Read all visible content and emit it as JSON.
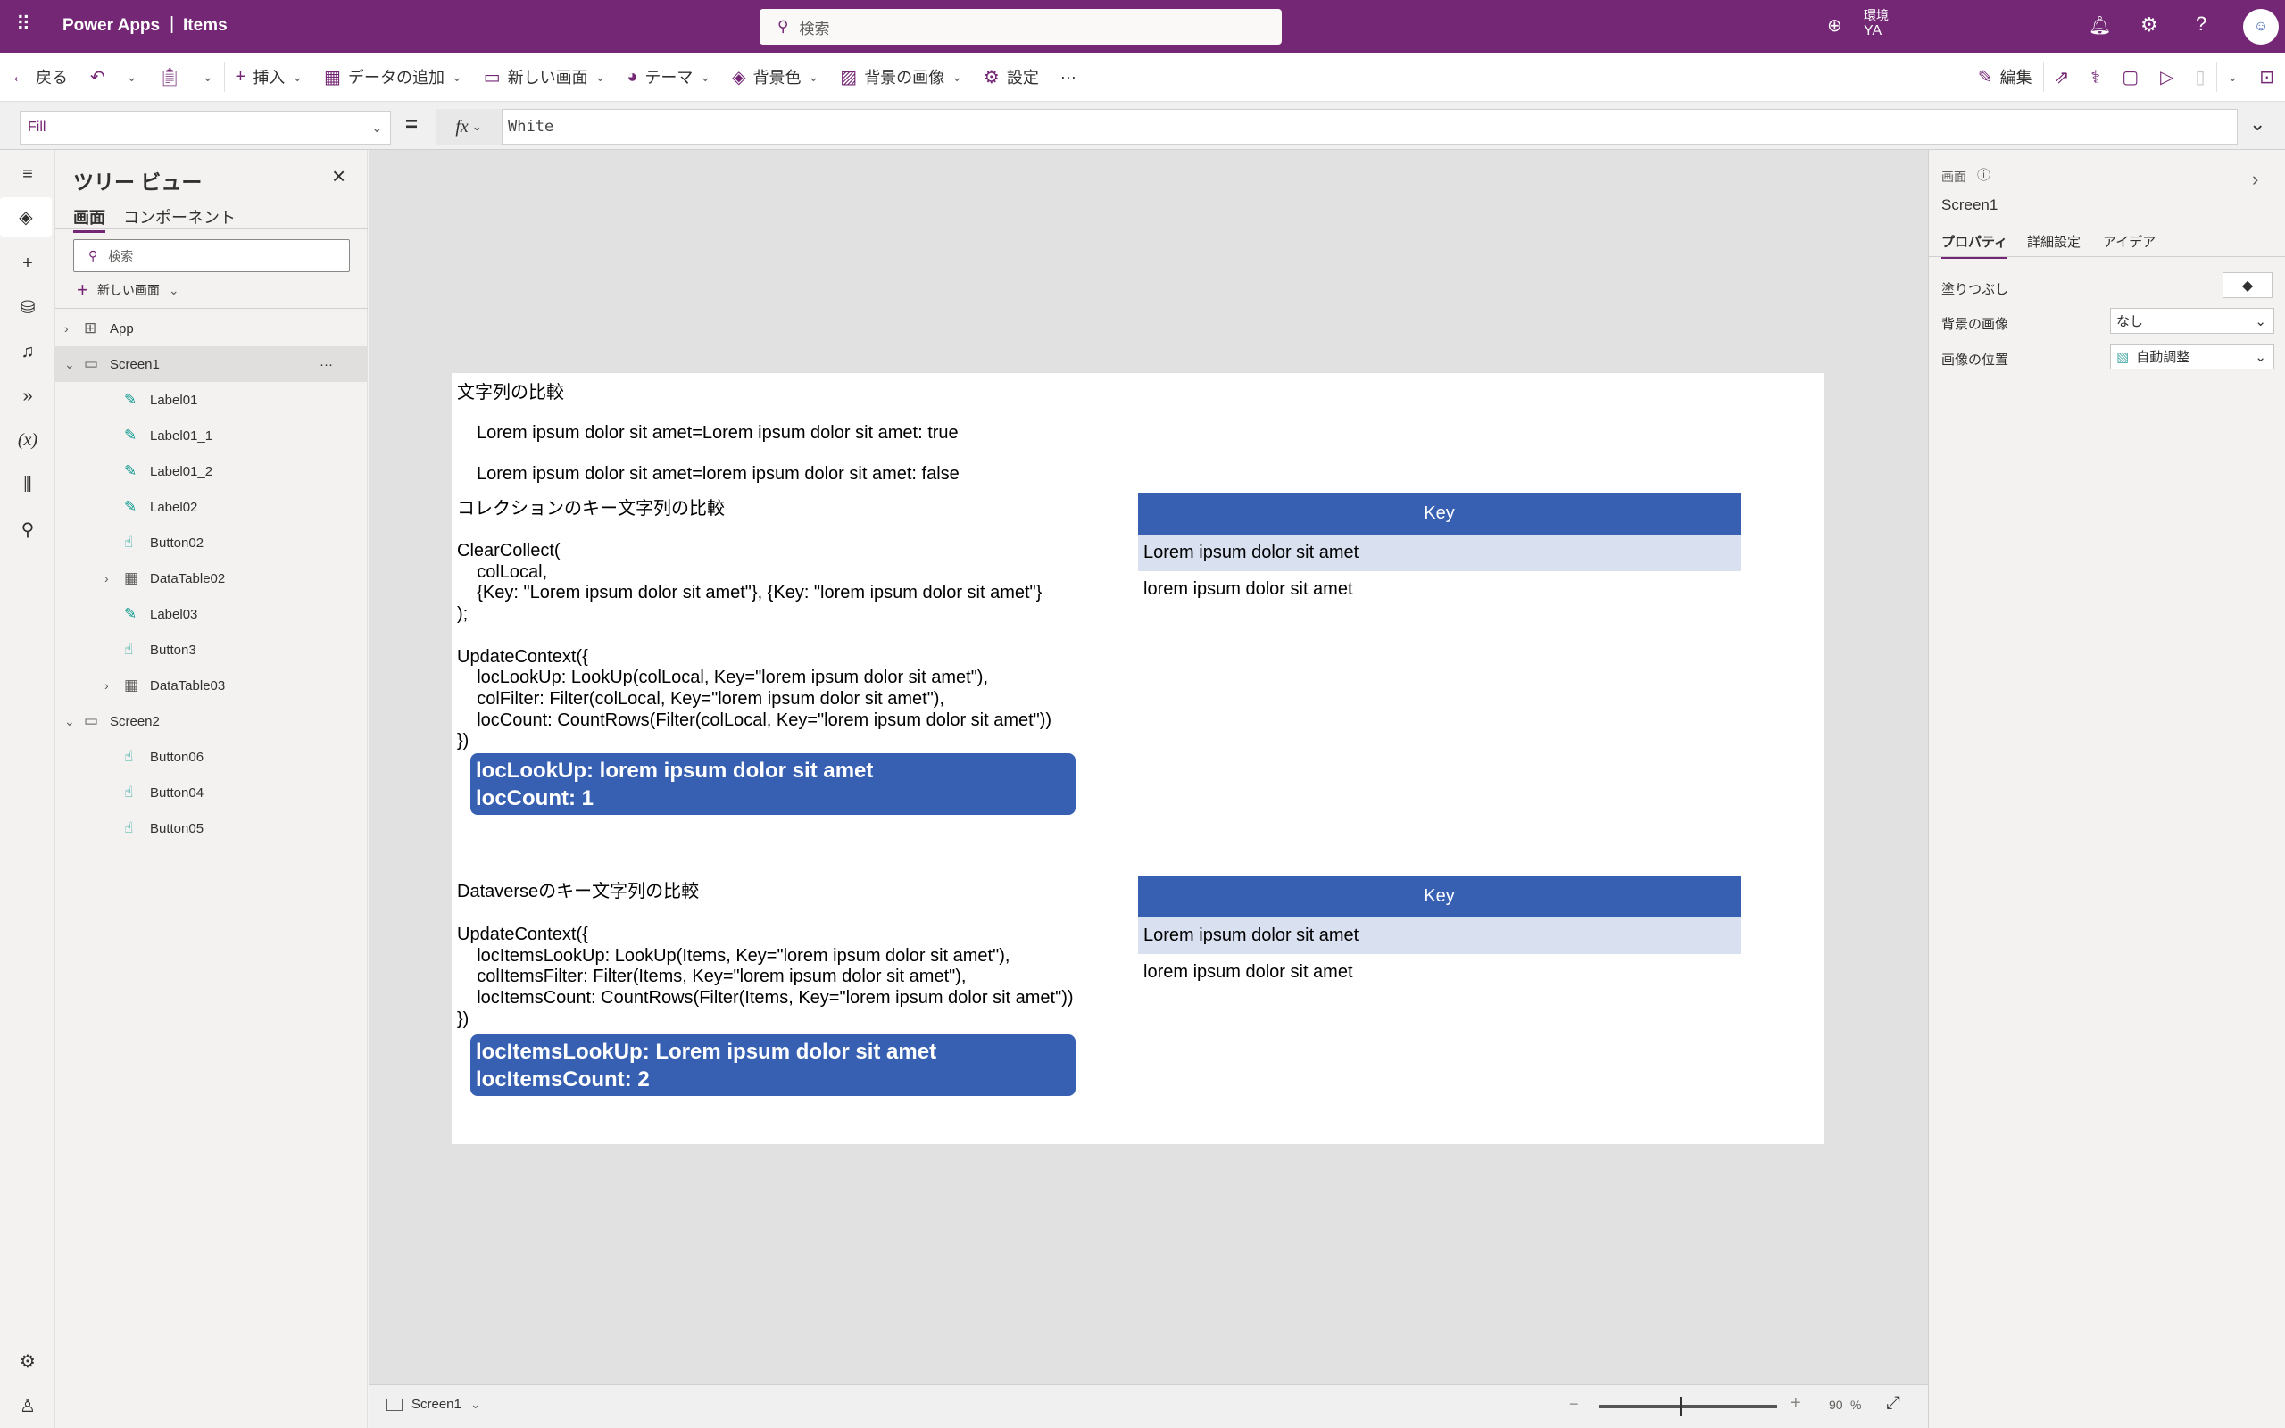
{
  "header": {
    "app_name": "Power Apps",
    "separator": "|",
    "app_title": "Items",
    "search_placeholder": "検索",
    "env_label": "環境",
    "env_name": "YA"
  },
  "toolbar": {
    "back": "戻る",
    "insert": "挿入",
    "add_data": "データの追加",
    "new_screen": "新しい画面",
    "theme": "テーマ",
    "bg_color": "背景色",
    "bg_image": "背景の画像",
    "settings": "設定",
    "more": "···",
    "edit": "編集"
  },
  "formula": {
    "property": "Fill",
    "equals": "=",
    "fx": "fx",
    "value": "White"
  },
  "tree": {
    "title": "ツリー ビュー",
    "tabs": [
      "画面",
      "コンポーネント"
    ],
    "search_placeholder": "検索",
    "new_screen": "新しい画面",
    "items": [
      {
        "label": "App",
        "level": 0,
        "icon": "app",
        "expander": ">"
      },
      {
        "label": "Screen1",
        "level": 0,
        "icon": "screen",
        "expander": "v",
        "selected": true
      },
      {
        "label": "Label01",
        "level": 1,
        "icon": "label"
      },
      {
        "label": "Label01_1",
        "level": 1,
        "icon": "label"
      },
      {
        "label": "Label01_2",
        "level": 1,
        "icon": "label"
      },
      {
        "label": "Label02",
        "level": 1,
        "icon": "label"
      },
      {
        "label": "Button02",
        "level": 1,
        "icon": "button"
      },
      {
        "label": "DataTable02",
        "level": 1,
        "icon": "table",
        "expander": ">"
      },
      {
        "label": "Label03",
        "level": 1,
        "icon": "label"
      },
      {
        "label": "Button3",
        "level": 1,
        "icon": "button"
      },
      {
        "label": "DataTable03",
        "level": 1,
        "icon": "table",
        "expander": ">"
      },
      {
        "label": "Screen2",
        "level": 0,
        "icon": "screen",
        "expander": "v"
      },
      {
        "label": "Button06",
        "level": 1,
        "icon": "button"
      },
      {
        "label": "Button04",
        "level": 1,
        "icon": "button"
      },
      {
        "label": "Button05",
        "level": 1,
        "icon": "button"
      }
    ],
    "more": "···"
  },
  "canvas": {
    "heading1": "文字列の比較",
    "compare_true": "Lorem ipsum dolor sit amet=Lorem ipsum dolor sit amet: true",
    "compare_false": "Lorem ipsum dolor sit amet=lorem ipsum dolor sit amet: false",
    "heading2": "コレクションのキー文字列の比較",
    "code1": [
      "ClearCollect(",
      "    colLocal,",
      "    {Key: \"Lorem ipsum dolor sit amet\"}, {Key: \"lorem ipsum dolor sit amet\"}",
      ");",
      "",
      "UpdateContext({",
      "    locLookUp: LookUp(colLocal, Key=\"lorem ipsum dolor sit amet\"),",
      "    colFilter: Filter(colLocal, Key=\"lorem ipsum dolor sit amet\"),",
      "    locCount: CountRows(Filter(colLocal, Key=\"lorem ipsum dolor sit amet\"))",
      "})"
    ],
    "result1": [
      "locLookUp: lorem ipsum dolor sit amet",
      "locCount: 1"
    ],
    "heading3": "Dataverseのキー文字列の比較",
    "code2": [
      "UpdateContext({",
      "    locItemsLookUp: LookUp(Items, Key=\"lorem ipsum dolor sit amet\"),",
      "    colItemsFilter: Filter(Items, Key=\"lorem ipsum dolor sit amet\"),",
      "    locItemsCount: CountRows(Filter(Items, Key=\"lorem ipsum dolor sit amet\"))",
      "})"
    ],
    "result2": [
      "locItemsLookUp: Lorem ipsum dolor sit amet",
      "locItemsCount: 2"
    ],
    "table1": {
      "header": "Key",
      "rows": [
        "Lorem ipsum dolor sit amet",
        "lorem ipsum dolor sit amet"
      ]
    },
    "table2": {
      "header": "Key",
      "rows": [
        "Lorem ipsum dolor sit amet",
        "lorem ipsum dolor sit amet"
      ]
    }
  },
  "status": {
    "screen": "Screen1",
    "zoom": "90",
    "zoom_unit": "%",
    "minus": "−",
    "plus": "+"
  },
  "props": {
    "type": "画面",
    "name": "Screen1",
    "tabs": [
      "プロパティ",
      "詳細設定",
      "アイデア"
    ],
    "fill_label": "塗りつぶし",
    "bg_image_label": "背景の画像",
    "bg_image_value": "なし",
    "image_pos_label": "画像の位置",
    "image_pos_value": "自動調整"
  },
  "colors": {
    "brand": "#742774",
    "accent": "#3760b3",
    "selected_row": "#d9e0f0"
  }
}
